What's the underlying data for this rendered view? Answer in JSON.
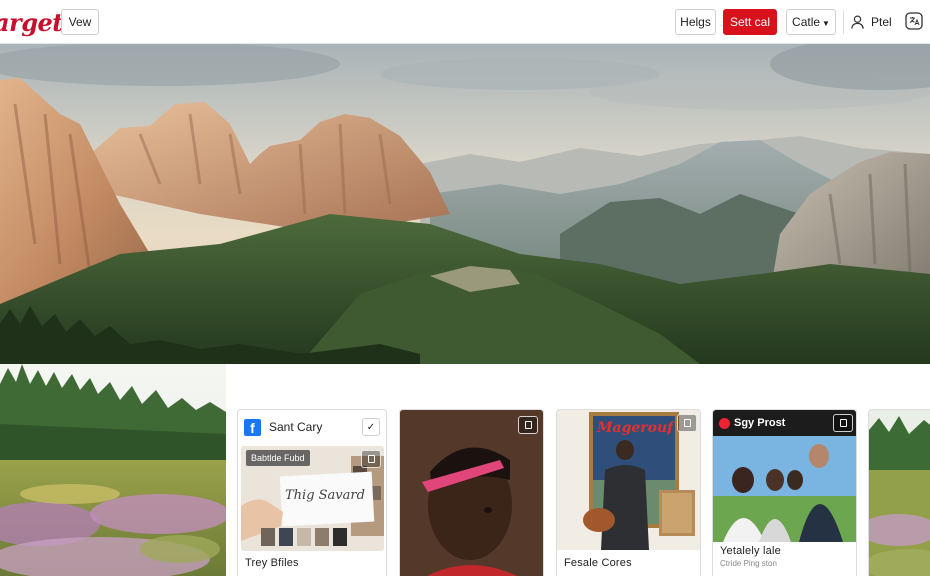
{
  "header": {
    "brand": "arget",
    "view_label": "Vew",
    "help_label": "Helgs",
    "primary_label": "Sett cal",
    "category_label": "Catle",
    "user_label": "Ptel"
  },
  "cards": [
    {
      "header_label": "Sant Cary",
      "badge": "Babtlde Fubd",
      "note_text": "Thig Savard",
      "title": "Trey Bfiles",
      "subtitle": ""
    },
    {
      "title": "",
      "subtitle": ""
    },
    {
      "poster_text": "Magerouf",
      "title": "Fesale Cores",
      "subtitle": ""
    },
    {
      "header_label": "Sgy Prost",
      "title": "Yetalely lale",
      "subtitle": "Ctride Ping ston"
    },
    {
      "title": ""
    }
  ],
  "colors": {
    "brand": "#c8102e",
    "primary": "#d8111d",
    "facebook": "#1877f2"
  }
}
